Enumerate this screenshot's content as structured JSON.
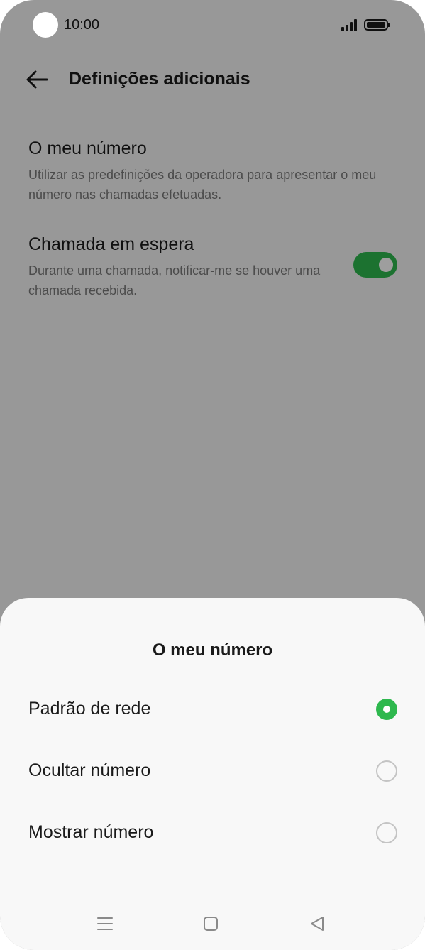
{
  "status_bar": {
    "time": "10:00"
  },
  "header": {
    "title": "Definições adicionais"
  },
  "settings": [
    {
      "title": "O meu número",
      "description": "Utilizar as predefinições da operadora para apresentar o meu número nas chamadas efetuadas."
    },
    {
      "title": "Chamada em espera",
      "description": "Durante uma chamada, notificar-me se houver uma chamada recebida.",
      "toggle_on": true
    }
  ],
  "sheet": {
    "title": "O meu número",
    "options": [
      {
        "label": "Padrão de rede",
        "selected": true
      },
      {
        "label": "Ocultar número",
        "selected": false
      },
      {
        "label": "Mostrar número",
        "selected": false
      }
    ]
  },
  "nav": {
    "icons": [
      "menu-icon",
      "home-icon",
      "back-triangle-icon"
    ]
  },
  "colors": {
    "accent": "#2eb84e",
    "scrim": "rgba(0,0,0,0.38)"
  }
}
